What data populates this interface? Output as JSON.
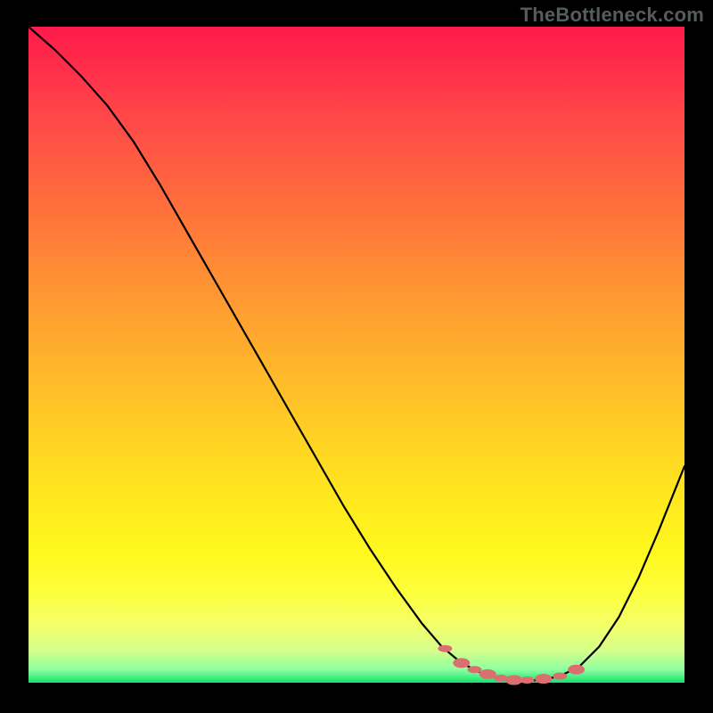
{
  "watermark": "TheBottleneck.com",
  "colors": {
    "curve": "#000000",
    "marker": "#d9706f",
    "background_top": "#ff1a4a",
    "background_bottom": "#14e26e"
  },
  "chart_data": {
    "type": "line",
    "title": "",
    "xlabel": "",
    "ylabel": "",
    "xlim": [
      0,
      100
    ],
    "ylim": [
      0,
      100
    ],
    "grid": false,
    "series": [
      {
        "name": "bottleneck-curve",
        "x": [
          0,
          4,
          8,
          12,
          16,
          20,
          24,
          28,
          32,
          36,
          40,
          44,
          48,
          52,
          56,
          60,
          63,
          66,
          69,
          72,
          75,
          78,
          81,
          84,
          87,
          90,
          93,
          96,
          100
        ],
        "y": [
          100,
          96.5,
          92.5,
          88.0,
          82.5,
          76.0,
          69.0,
          62.0,
          55.0,
          48.0,
          41.0,
          34.0,
          27.0,
          20.5,
          14.5,
          9.0,
          5.5,
          3.0,
          1.5,
          0.7,
          0.3,
          0.4,
          1.0,
          2.5,
          5.5,
          10.0,
          16.0,
          23.0,
          33.0
        ]
      }
    ],
    "markers": {
      "name": "highlight-dots",
      "color": "#d9706f",
      "x": [
        63.5,
        66,
        68,
        70,
        72,
        74,
        76,
        78.5,
        81,
        83.5
      ],
      "y": [
        5.2,
        3.0,
        2.0,
        1.3,
        0.7,
        0.4,
        0.4,
        0.6,
        1.0,
        2.0
      ]
    }
  }
}
